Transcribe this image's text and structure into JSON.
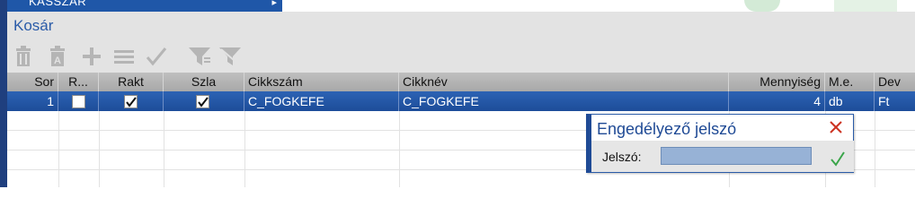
{
  "top_menu": {
    "label": "KASSZÁR",
    "arrow": "▸"
  },
  "panel": {
    "title": "Kosár"
  },
  "toolbar": {
    "buttons": [
      {
        "name": "delete",
        "icon": "trash-icon"
      },
      {
        "name": "delete-all",
        "icon": "trash-a-icon"
      },
      {
        "name": "add",
        "icon": "plus-icon"
      },
      {
        "name": "list",
        "icon": "list-icon"
      },
      {
        "name": "confirm",
        "icon": "check-icon"
      },
      {
        "name": "filter",
        "icon": "filter-icon"
      },
      {
        "name": "clear-filter",
        "icon": "filter-clear-icon"
      }
    ]
  },
  "grid": {
    "headers": {
      "sor": "Sor",
      "r": "R...",
      "rakt": "Rakt",
      "szla": "Szla",
      "cikkszam": "Cikkszám",
      "cikknev": "Cikknév",
      "mennyiseg": "Mennyiség",
      "me": "M.e.",
      "dev": "Dev"
    },
    "rows": [
      {
        "sor": "1",
        "r_checked": false,
        "rakt_checked": true,
        "szla_checked": true,
        "cikkszam": "C_FOGKEFE",
        "cikknev": "C_FOGKEFE",
        "mennyiseg": "4",
        "me": "db",
        "dev": "Ft"
      }
    ]
  },
  "popup": {
    "title": "Engedélyező jelszó",
    "label": "Jelszó:",
    "value": ""
  },
  "colors": {
    "accent": "#2a5ba8",
    "selected_row": "#2c63b4",
    "frame": "#1f3f7e",
    "close": "#cc3322",
    "ok": "#3aa54a"
  }
}
